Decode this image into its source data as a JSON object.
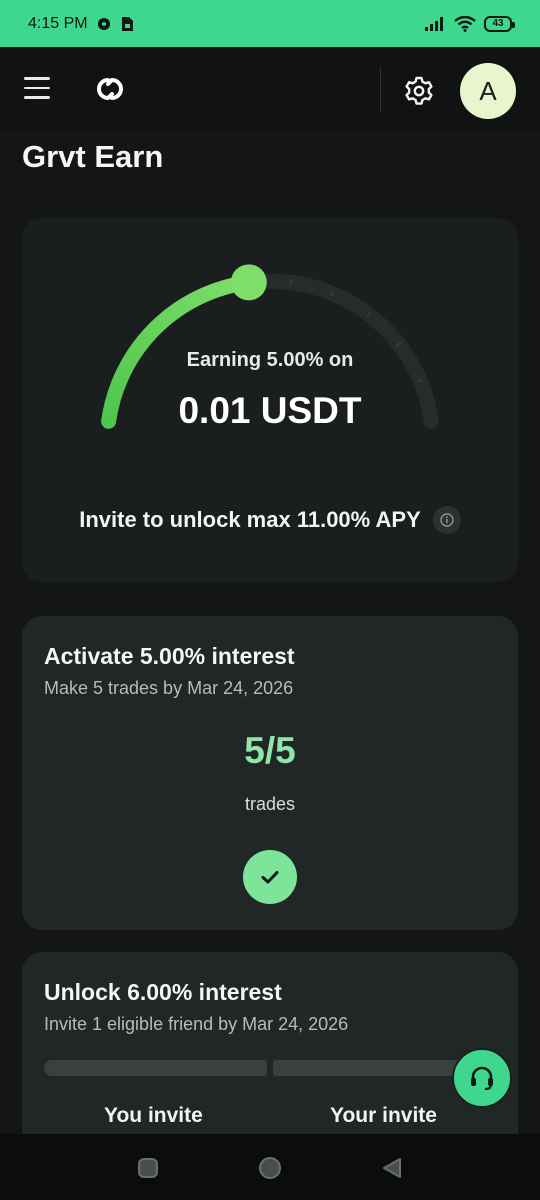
{
  "status_bar": {
    "time": "4:15 PM",
    "battery": "43"
  },
  "header": {
    "menu_icon": "hamburger-menu-icon",
    "logo_icon": "grvt-logo-icon",
    "settings_icon": "gear-icon",
    "avatar_initial": "A"
  },
  "page": {
    "title": "Grvt Earn"
  },
  "earn_card": {
    "earning_label": "Earning 5.00% on",
    "amount": "0.01 USDT",
    "invite_text": "Invite to unlock max 11.00% APY",
    "info_icon": "info-icon",
    "gauge_progress_fraction": 0.4545,
    "gauge_color": "#6ad06a"
  },
  "task_activate": {
    "title": "Activate 5.00% interest",
    "subtitle": "Make 5 trades by Mar 24, 2026",
    "progress": "5/5",
    "unit": "trades",
    "status_icon": "checkmark-icon"
  },
  "task_unlock": {
    "title": "Unlock 6.00% interest",
    "subtitle": "Invite 1 eligible friend by Mar 24, 2026",
    "col_left": "You invite",
    "col_right": "Your invite"
  },
  "support": {
    "icon": "headset-icon"
  },
  "nav": {
    "recents_icon": "square-icon",
    "home_icon": "circle-icon",
    "back_icon": "triangle-back-icon"
  },
  "colors": {
    "accent_green": "#3fd68e",
    "progress_green": "#8fe6a8"
  }
}
